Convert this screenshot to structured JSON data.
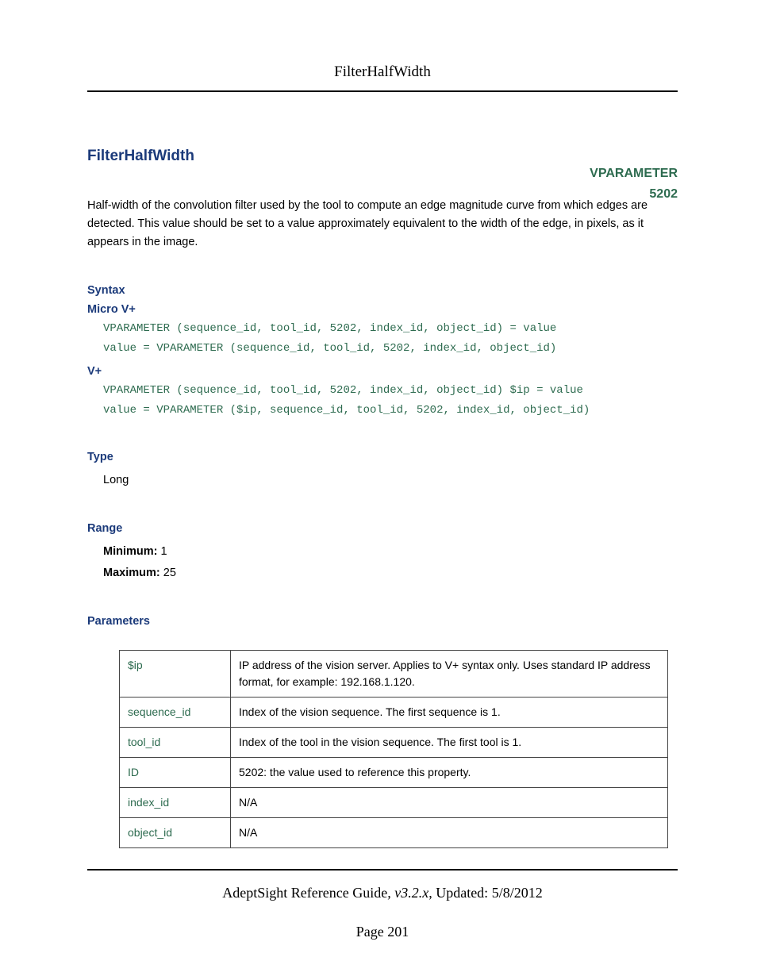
{
  "header": {
    "running_title": "FilterHalfWidth"
  },
  "title": "FilterHalfWidth",
  "tag": {
    "label": "VPARAMETER",
    "code": "5202"
  },
  "description": "Half-width of the convolution filter used by the tool to compute an edge magnitude curve from which edges are detected. This value should be set to a value approximately equivalent to the width of the edge, in pixels, as it appears in the image.",
  "syntax": {
    "heading": "Syntax",
    "micro_label": "Micro V+",
    "micro_code": "VPARAMETER (sequence_id, tool_id, 5202, index_id, object_id) = value\nvalue = VPARAMETER (sequence_id, tool_id, 5202, index_id, object_id)",
    "vplus_label": "V+",
    "vplus_code": "VPARAMETER (sequence_id, tool_id, 5202, index_id, object_id) $ip = value\nvalue = VPARAMETER ($ip, sequence_id, tool_id, 5202, index_id, object_id)"
  },
  "type": {
    "heading": "Type",
    "value": "Long"
  },
  "range": {
    "heading": "Range",
    "min_label": "Minimum:",
    "min_value": "1",
    "max_label": "Maximum:",
    "max_value": "25"
  },
  "parameters": {
    "heading": "Parameters",
    "rows": [
      {
        "name": "$ip",
        "desc": "IP address of the vision server. Applies to V+ syntax only. Uses standard IP address format, for example: 192.168.1.120."
      },
      {
        "name": "sequence_id",
        "desc": "Index of the vision sequence. The first sequence is 1."
      },
      {
        "name": "tool_id",
        "desc": "Index of the tool in the vision sequence. The first tool is 1."
      },
      {
        "name": "ID",
        "desc": "5202: the value used to reference this property."
      },
      {
        "name": "index_id",
        "desc": "N/A"
      },
      {
        "name": "object_id",
        "desc": "N/A"
      }
    ]
  },
  "footer": {
    "doc_title": "AdeptSight Reference Guide",
    "version": ", v3.2.x",
    "updated_label": ", Updated: ",
    "updated_date": "5/8/2012",
    "page_label": "Page ",
    "page_number": "201"
  }
}
